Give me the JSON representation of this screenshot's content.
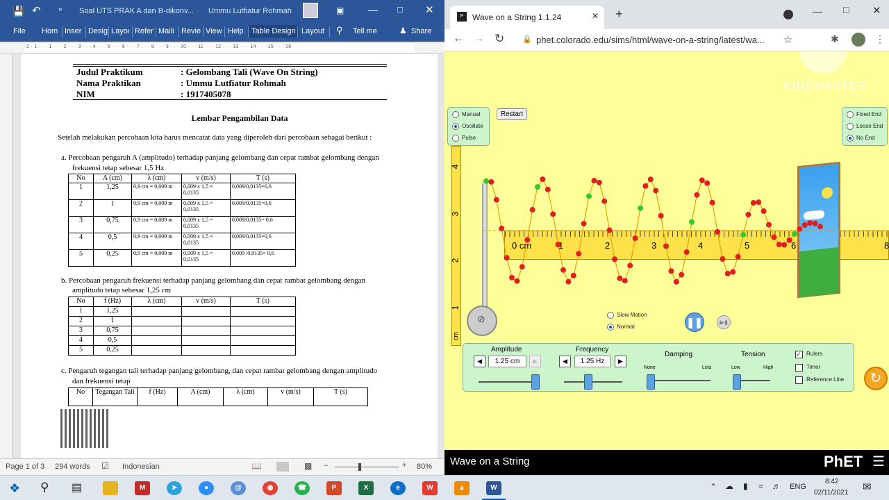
{
  "word": {
    "title": "Soal UTS PRAK A dan B-dikonv...",
    "user": "Ummu Lutfiatur Rohmah",
    "tabs": [
      "File",
      "Hom",
      "Inser",
      "Desig",
      "Layoı",
      "Refer",
      "Maili",
      "Revie",
      "View",
      "Help",
      "Table Design",
      "Layout"
    ],
    "tellme": "Tell me",
    "share": "Share",
    "ruler": "2 · 1 · · · 1 · · · 2 · · · 3 · · · 4 · · · 5 · · · 6 · · · 7 · · · 8 · · · 9 · · · 10 · · · 11 · · · 12 · · · 13 · · · 14 · · · 15 · · · 16",
    "doc": {
      "header_rows": [
        {
          "label": "Judul Praktikum",
          "value": ": Gelombang Tali (Wave On String)"
        },
        {
          "label": "Nama Praktikan",
          "value": ": Ummu Lutfiatur Rohmah"
        },
        {
          "label": "NIM",
          "value": ": 1917405078"
        }
      ],
      "heading": "Lembar Pengambilan Data",
      "intro": "Setelah melakukan percobaan kita harus mencatat data yang diperoleh dari percobaan sebagai berikut :",
      "sec_a_1": "a.    Percobaan pengaruh A (amplitudo) terhadap panjang gelombang dan cepat rambat gelombang dengan",
      "sec_a_2": "frekuensi tetap sebesar 1,5 Hz",
      "table_a": {
        "headers": [
          "No",
          "A (cm)",
          "λ (cm)",
          "v (m/s)",
          "T (s)"
        ],
        "rows": [
          [
            "1",
            "1,25",
            "0,9 cm = 0,009 m",
            "0,009 x 1,5 = 0,0135",
            "0,009/0,0135=0,6"
          ],
          [
            "2",
            "1",
            "0,9 cm = 0,009 m",
            "0,009 x 1,5 = 0,0135",
            "0,009/0,0135=0,6"
          ],
          [
            "3",
            "0,75",
            "0,9 cm = 0,009 m",
            "0,009 x 1,5 = 0,0135",
            "0,009/0,0135= 0,6"
          ],
          [
            "4",
            "0,5",
            "0,9 cm = 0,009 m",
            "0,009 x 1,5 = 0,0135",
            "0,009/0,0135=0,6"
          ],
          [
            "5",
            "0,25",
            "0,9 cm = 0,009 m",
            "0,009 x 1,5 = 0,0135",
            "0,009 /0,0135= 0,6"
          ]
        ]
      },
      "sec_b_1": "b.    Percobaan pengaruh frekuensi terhadap panjang gelombang dan cepat rambat gelombang dengan",
      "sec_b_2": "amplitudo tetap sebesar 1,25 cm",
      "table_b": {
        "headers": [
          "No",
          "f (Hz)",
          "λ (cm)",
          "v (m/s)",
          "T (s)"
        ],
        "rows": [
          [
            "1",
            "1,25"
          ],
          [
            "2",
            "1"
          ],
          [
            "3",
            "0,75"
          ],
          [
            "4",
            "0,5"
          ],
          [
            "5",
            "0,25"
          ]
        ]
      },
      "sec_c_1": "c.    Pengaruh tegangan tali terhadap panjang gelombang, dan cepat rambat gelombang dengan amplitudo",
      "sec_c_2": "dan frekuensi tetap",
      "table_c": {
        "headers": [
          "No",
          "Tegangan Tali",
          "f (Hz)",
          "A (cm)",
          "λ (cm)",
          "v (m/s)",
          "T (s)"
        ]
      }
    },
    "status": {
      "page": "Page 1 of 3",
      "words": "294 words",
      "lang": "Indonesian",
      "zoom": "80%"
    }
  },
  "browser": {
    "tab_title": "Wave on a String 1.1.24",
    "url": "phet.colorado.edu/sims/html/wave-on-a-string/latest/wa...",
    "watermark": "KINEMASTER"
  },
  "sim": {
    "modes": [
      "Manual",
      "Oscillate",
      "Pulse"
    ],
    "selected_mode": "Oscillate",
    "restart": "Restart",
    "ends": [
      "Fixed End",
      "Loose End",
      "No End"
    ],
    "selected_end": "No End",
    "speed": [
      "Slow Motion",
      "Normal"
    ],
    "selected_speed": "Normal",
    "amplitude": {
      "label": "Amplitude",
      "value": "1.25 cm"
    },
    "frequency": {
      "label": "Frequency",
      "value": "1.25 Hz"
    },
    "damping": {
      "label": "Damping",
      "min": "None",
      "max": "Lots"
    },
    "tension": {
      "label": "Tension",
      "min": "Low",
      "max": "High"
    },
    "checks": [
      {
        "label": "Rulers",
        "checked": true
      },
      {
        "label": "Timer",
        "checked": false
      },
      {
        "label": "Reference Line",
        "checked": false
      }
    ],
    "ruler_h": [
      "0 cm",
      "1",
      "2",
      "3",
      "4",
      "5",
      "6",
      "8"
    ],
    "ruler_v": [
      "4",
      "3",
      "2",
      "1",
      "cm"
    ],
    "footer_title": "Wave on a String",
    "logo": "PhET"
  },
  "taskbar": {
    "lang": "ENG",
    "time": "8:42",
    "date": "02/11/2021"
  },
  "colors": {
    "word_blue": "#2b579a",
    "sim_bg": "#ffff99",
    "bead": "#e02020",
    "bead_green": "#2ecc2e",
    "ruler": "#ffe24a"
  }
}
